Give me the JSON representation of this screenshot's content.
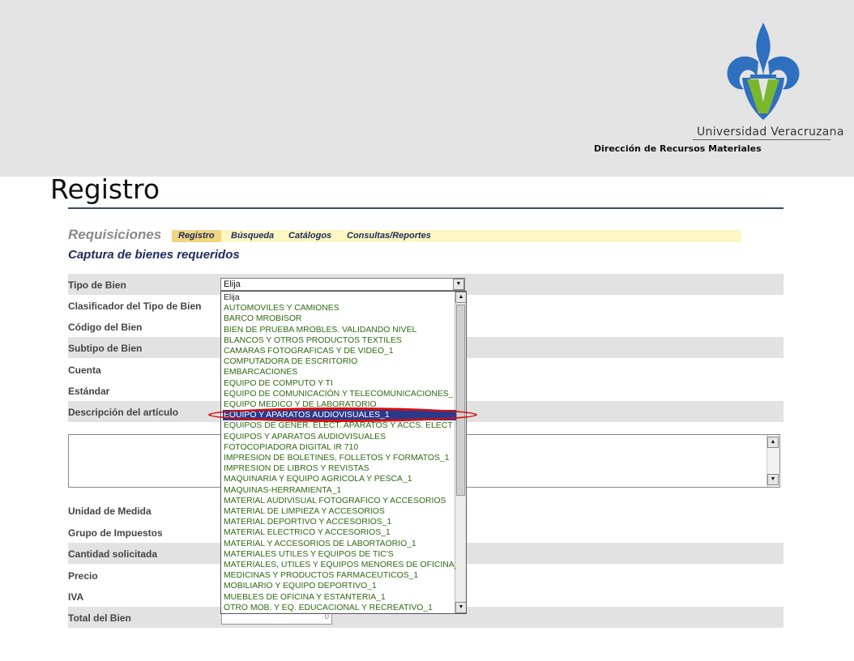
{
  "header": {
    "university": "Universidad Veracruzana",
    "department": "Dirección de Recursos Materiales",
    "colors": {
      "logo_blue": "#2f6fbf",
      "logo_green": "#7ab72e",
      "band": "#e4e4e4"
    }
  },
  "slide": {
    "title": "Registro"
  },
  "app": {
    "title": "Requisiciones",
    "menu": [
      "Registro",
      "Búsqueda",
      "Catálogos",
      "Consultas/Reportes"
    ],
    "active_menu": "Registro",
    "subtitle": "Captura de bienes requeridos"
  },
  "form": {
    "labels": {
      "tipo_bien": "Tipo de Bien",
      "clasificador": "Clasificador del Tipo de Bien",
      "codigo": "Código del Bien",
      "subtipo": "Subtipo de Bien",
      "cuenta": "Cuenta",
      "estandar": "Estándar",
      "descripcion": "Descripción del artículo",
      "unidad": "Unidad de Medida",
      "grupo": "Grupo de Impuestos",
      "cantidad": "Cantidad solicitada",
      "precio": "Precio",
      "iva": "IVA",
      "total": "Total del Bien"
    },
    "tipo_bien_value": "Elija",
    "total_value": "0"
  },
  "dropdown": {
    "selected_index": 11,
    "options": [
      "Elija",
      "AUTOMOVILES Y CAMIONES",
      "BARCO MROBISOR",
      "BIEN DE PRUEBA MROBLES. VALIDANDO NIVEL",
      "BLANCOS Y OTROS PRODUCTOS TEXTILES",
      "CAMARAS FOTOGRAFICAS Y DE VIDEO_1",
      "COMPUTADORA DE ESCRITORIO",
      "EMBARCACIONES",
      "EQUIPO DE COMPUTO Y TI",
      "EQUIPO DE COMUNICACIÓN Y TELECOMUNICACIONES_",
      "EQUIPO MEDICO Y DE LABORATORIO",
      "EQUIPO Y APARATOS AUDIOVISUALES_1",
      "EQUIPOS DE GENER. ELECT. APARATOS Y ACCS. ELECT",
      "EQUIPOS Y APARATOS AUDIOVISUALES",
      "FOTOCOPIADORA DIGITAL IR 710",
      "IMPRESION DE BOLETINES, FOLLETOS Y FORMATOS_1",
      "IMPRESION DE LIBROS Y REVISTAS",
      "MAQUINARIA Y EQUIPO AGRICOLA Y PESCA_1",
      "MAQUINAS-HERRAMIENTA_1",
      "MATERIAL AUDIVISUAL FOTOGRAFICO Y ACCESORIOS",
      "MATERIAL DE LIMPIEZA Y ACCESORIOS",
      "MATERIAL DEPORTIVO Y ACCESORIOS_1",
      "MATERIAL ELECTRICO Y ACCESORIOS_1",
      "MATERIAL Y ACCESORIOS DE LABORTAORIO_1",
      "MATERIALES UTILES Y EQUIPOS DE TIC'S",
      "MATERIALES, UTILES Y EQUIPOS MENORES DE OFICINA_",
      "MEDICINAS Y PRODUCTOS FARMACEUTICOS_1",
      "MOBILIARIO Y EQUIPO DEPORTIVO_1",
      "MUEBLES DE OFICINA Y ESTANTERIA_1",
      "OTRO MOB. Y EQ. EDUCACIONAL Y RECREATIVO_1"
    ]
  },
  "icons": {
    "scroll_up": "▲",
    "scroll_down": "▼",
    "select_arrow": "▼"
  }
}
